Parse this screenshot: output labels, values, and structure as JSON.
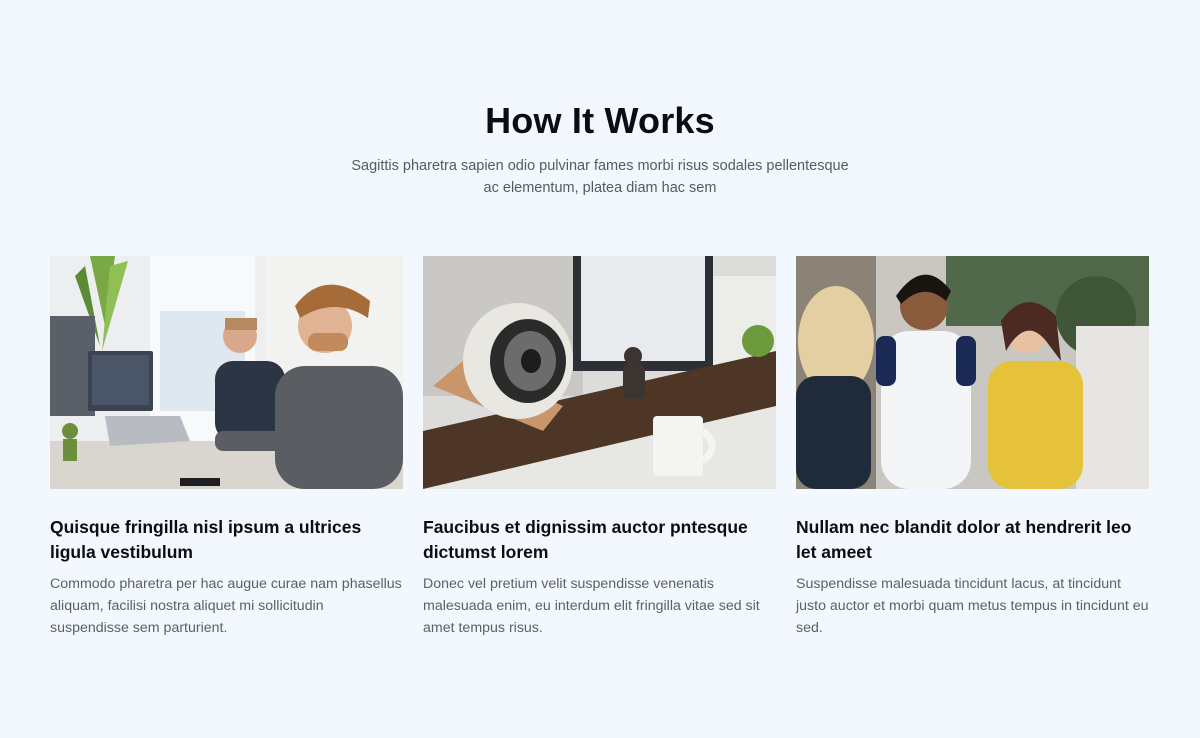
{
  "section": {
    "title": "How It Works",
    "subtitle": "Sagittis pharetra sapien odio pulvinar fames morbi risus sodales pellentesque ac elementum, platea diam hac sem"
  },
  "cards": [
    {
      "title": "Quisque fringilla nisl ipsum a ultrices ligula vestibulum",
      "text": "Commodo pharetra per hac augue curae nam phasellus aliquam, facilisi nostra aliquet mi sollicitudin suspendisse sem parturient."
    },
    {
      "title": "Faucibus et dignissim auctor pntesque dictumst lorem",
      "text": "Donec vel pretium velit suspendisse venenatis malesuada enim, eu interdum elit fringilla vitae sed sit amet tempus risus."
    },
    {
      "title": "Nullam nec blandit dolor at hendrerit leo let ameet",
      "text": "Suspendisse malesuada tincidunt lacus, at tincidunt justo auctor et morbi quam metus tempus in tincidunt eu sed."
    }
  ]
}
